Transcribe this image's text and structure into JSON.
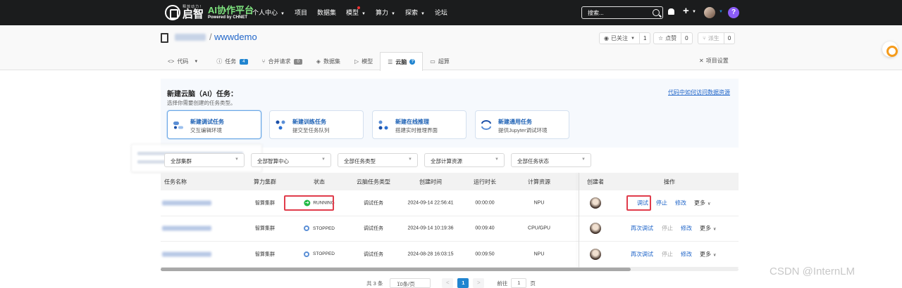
{
  "topnav": {
    "logo_slogan": "释放动力！",
    "logo_name": "启智",
    "logo_ai": "AI协作平台",
    "logo_powered": "Powered by CHNET",
    "menu": [
      {
        "label": "个人中心",
        "dropdown": true
      },
      {
        "label": "项目",
        "dropdown": false
      },
      {
        "label": "数据集",
        "dropdown": false
      },
      {
        "label": "模型",
        "dropdown": true,
        "dot": true
      },
      {
        "label": "算力",
        "dropdown": true
      },
      {
        "label": "探索",
        "dropdown": true
      },
      {
        "label": "论坛",
        "dropdown": false
      }
    ],
    "search_placeholder": "搜索...",
    "help": "?"
  },
  "repo": {
    "separator": "/",
    "name": "wwwdemo",
    "watch_label": "已关注",
    "watch_count": "1",
    "star_label": "点赞",
    "star_count": "0",
    "fork_label": "派生",
    "fork_count": "0",
    "settings_label": "项目设置",
    "tabs": [
      {
        "icon": "<>",
        "label": "代码",
        "caret": true
      },
      {
        "icon": "ⓘ",
        "label": "任务",
        "badge": "4"
      },
      {
        "icon": "⑂",
        "label": "合并请求",
        "badge": "0"
      },
      {
        "icon": "◈",
        "label": "数据集"
      },
      {
        "icon": "▷",
        "label": "模型"
      },
      {
        "icon": "☰",
        "label": "云脑",
        "active": true
      },
      {
        "icon": "▭",
        "label": "超算"
      }
    ]
  },
  "create": {
    "title": "新建云脑（AI）任务：",
    "subtitle": "选择你需要创建的任务类型。",
    "link": "代码中如何访问数据资源",
    "cards": [
      {
        "title": "新建调试任务",
        "subtitle": "交互编辑环境",
        "selected": true
      },
      {
        "title": "新建训练任务",
        "subtitle": "提交至任务队列"
      },
      {
        "title": "新建在线推理",
        "subtitle": "搭建实时推理界面"
      },
      {
        "title": "新建通用任务",
        "subtitle": "提供Jupyter调试环境"
      }
    ]
  },
  "filters": [
    "全部集群",
    "全部智算中心",
    "全部任务类型",
    "全部计算资源",
    "全部任务状态"
  ],
  "table": {
    "headers": [
      "任务名称",
      "算力集群",
      "状态",
      "云脑任务类型",
      "创建时间",
      "运行时长",
      "计算资源",
      "创建者",
      "操作"
    ],
    "rows": [
      {
        "cluster": "智算集群",
        "status": "RUNNING",
        "type": "调试任务",
        "created": "2024-09-14 22:56:41",
        "duration": "00:00:00",
        "resource": "NPU",
        "ops": [
          {
            "label": "调试",
            "style": "link"
          },
          {
            "label": "停止",
            "style": "link"
          },
          {
            "label": "修改",
            "style": "link"
          },
          {
            "label": "更多",
            "style": "more"
          }
        ]
      },
      {
        "cluster": "智算集群",
        "status": "STOPPED",
        "type": "调试任务",
        "created": "2024-09-14 10:19:36",
        "duration": "00:09:40",
        "resource": "CPU/GPU",
        "ops": [
          {
            "label": "再次调试",
            "style": "link"
          },
          {
            "label": "停止",
            "style": "disabled"
          },
          {
            "label": "修改",
            "style": "link"
          },
          {
            "label": "更多",
            "style": "more"
          }
        ]
      },
      {
        "cluster": "智算集群",
        "status": "STOPPED",
        "type": "调试任务",
        "created": "2024-08-28 16:03:15",
        "duration": "00:09:50",
        "resource": "NPU",
        "ops": [
          {
            "label": "再次调试",
            "style": "link"
          },
          {
            "label": "停止",
            "style": "disabled"
          },
          {
            "label": "修改",
            "style": "link"
          },
          {
            "label": "更多",
            "style": "more"
          }
        ]
      }
    ]
  },
  "pager": {
    "total": "共 3 条",
    "page_size": "10条/页",
    "prev": "<",
    "current": "1",
    "next": ">",
    "goto_label": "前往",
    "goto_value": "1",
    "goto_suffix": "页"
  },
  "watermark": "CSDN @InternLM",
  "colors": {
    "accent": "#2185d0",
    "running": "#21ba45",
    "highlight": "#e03c4b"
  }
}
